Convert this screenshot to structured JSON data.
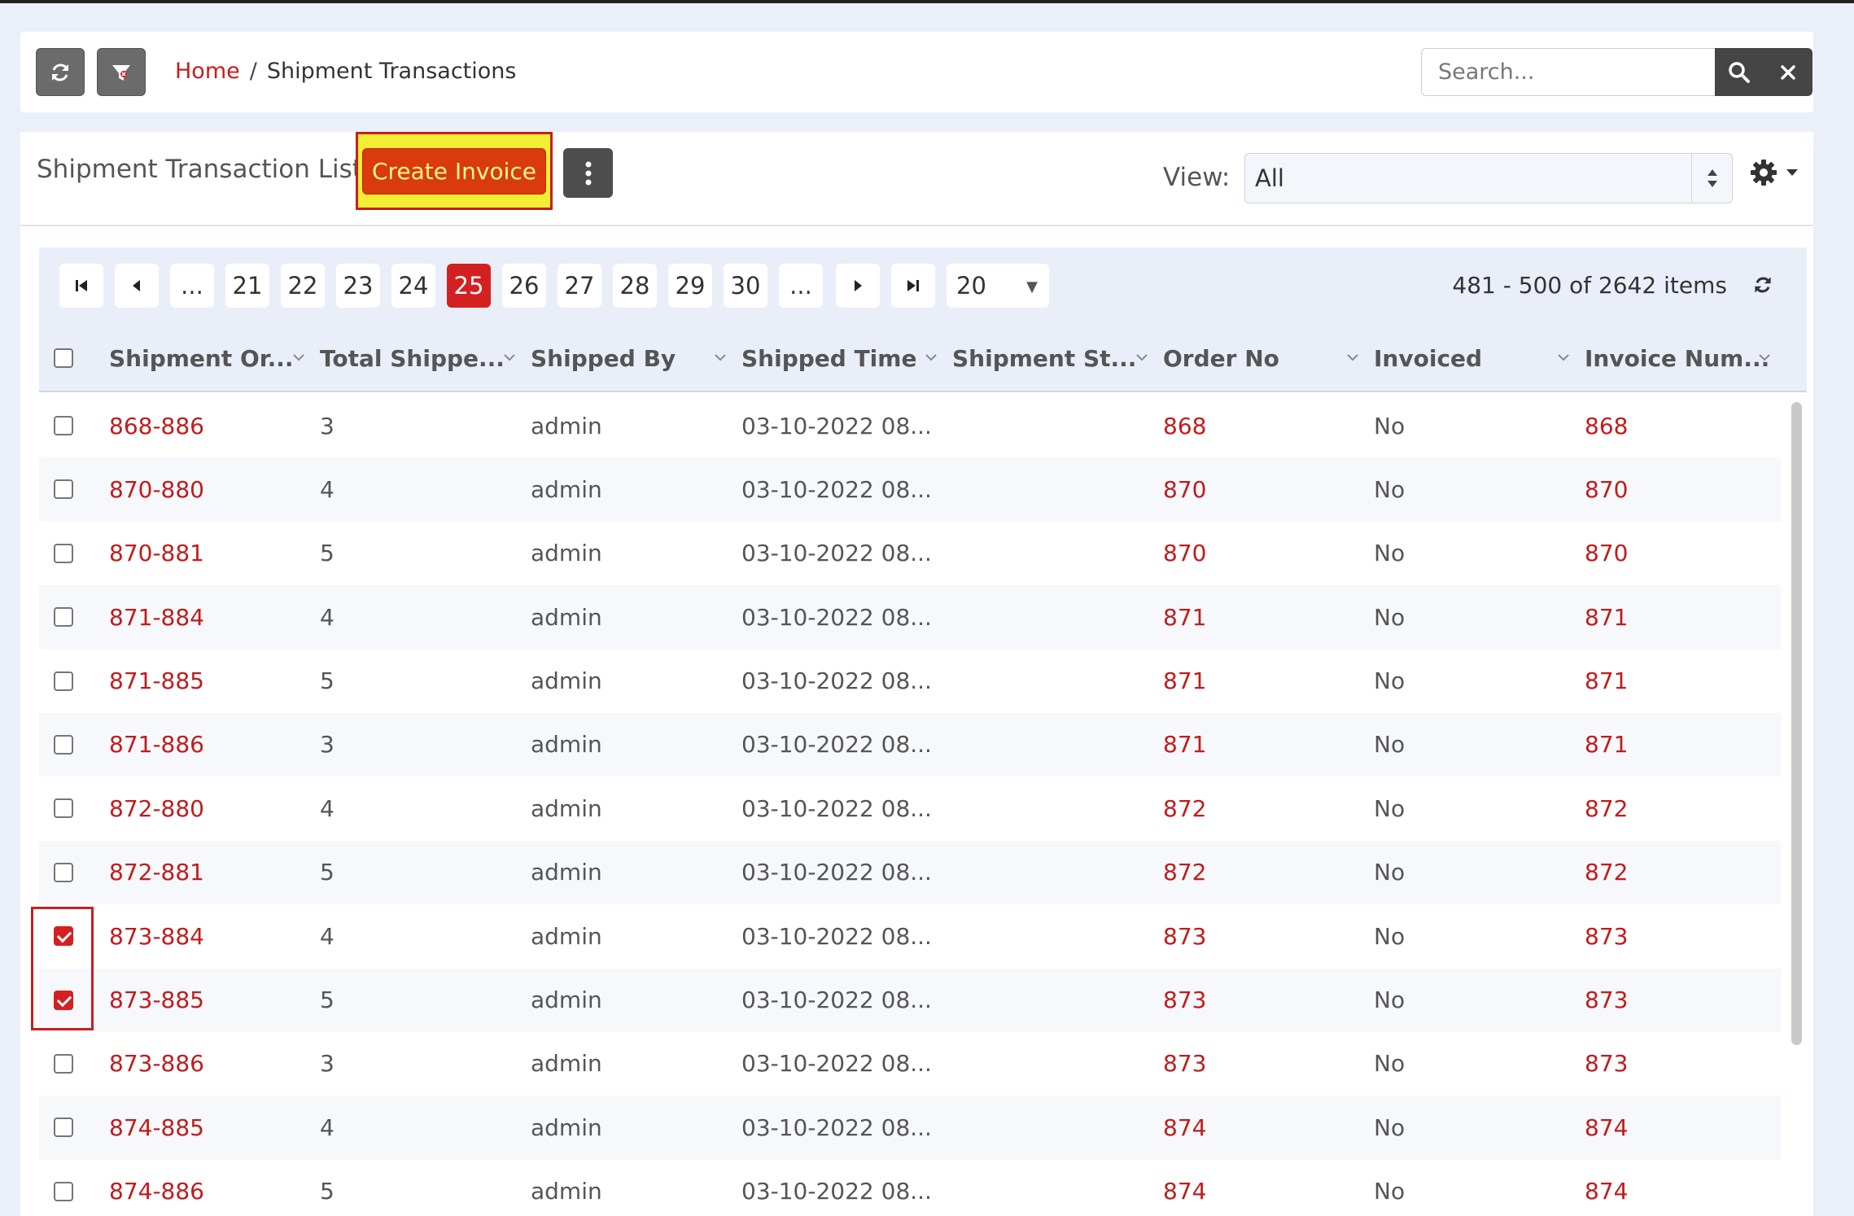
{
  "breadcrumb": {
    "home": "Home",
    "separator": "/",
    "current": "Shipment Transactions"
  },
  "search": {
    "placeholder": "Search..."
  },
  "panel": {
    "title": "Shipment Transaction List",
    "create_button": "Create Invoice",
    "view_label": "View:",
    "view_value": "All"
  },
  "pager": {
    "pages": [
      "...",
      "21",
      "22",
      "23",
      "24",
      "25",
      "26",
      "27",
      "28",
      "29",
      "30",
      "..."
    ],
    "active_page": "25",
    "page_size": "20",
    "info": "481 - 500 of 2642 items"
  },
  "columns": [
    "Shipment Or...",
    "Total Shippe...",
    "Shipped By",
    "Shipped Time",
    "Shipment St...",
    "Order No",
    "Invoiced",
    "Invoice Num..."
  ],
  "rows": [
    {
      "shipment": "868-886",
      "total": "3",
      "by": "admin",
      "time": "03-10-2022 08...",
      "status": "",
      "order": "868",
      "invoiced": "No",
      "invoice_num": "868",
      "checked": false
    },
    {
      "shipment": "870-880",
      "total": "4",
      "by": "admin",
      "time": "03-10-2022 08...",
      "status": "",
      "order": "870",
      "invoiced": "No",
      "invoice_num": "870",
      "checked": false
    },
    {
      "shipment": "870-881",
      "total": "5",
      "by": "admin",
      "time": "03-10-2022 08...",
      "status": "",
      "order": "870",
      "invoiced": "No",
      "invoice_num": "870",
      "checked": false
    },
    {
      "shipment": "871-884",
      "total": "4",
      "by": "admin",
      "time": "03-10-2022 08...",
      "status": "",
      "order": "871",
      "invoiced": "No",
      "invoice_num": "871",
      "checked": false
    },
    {
      "shipment": "871-885",
      "total": "5",
      "by": "admin",
      "time": "03-10-2022 08...",
      "status": "",
      "order": "871",
      "invoiced": "No",
      "invoice_num": "871",
      "checked": false
    },
    {
      "shipment": "871-886",
      "total": "3",
      "by": "admin",
      "time": "03-10-2022 08...",
      "status": "",
      "order": "871",
      "invoiced": "No",
      "invoice_num": "871",
      "checked": false
    },
    {
      "shipment": "872-880",
      "total": "4",
      "by": "admin",
      "time": "03-10-2022 08...",
      "status": "",
      "order": "872",
      "invoiced": "No",
      "invoice_num": "872",
      "checked": false
    },
    {
      "shipment": "872-881",
      "total": "5",
      "by": "admin",
      "time": "03-10-2022 08...",
      "status": "",
      "order": "872",
      "invoiced": "No",
      "invoice_num": "872",
      "checked": false
    },
    {
      "shipment": "873-884",
      "total": "4",
      "by": "admin",
      "time": "03-10-2022 08...",
      "status": "",
      "order": "873",
      "invoiced": "No",
      "invoice_num": "873",
      "checked": true
    },
    {
      "shipment": "873-885",
      "total": "5",
      "by": "admin",
      "time": "03-10-2022 08...",
      "status": "",
      "order": "873",
      "invoiced": "No",
      "invoice_num": "873",
      "checked": true
    },
    {
      "shipment": "873-886",
      "total": "3",
      "by": "admin",
      "time": "03-10-2022 08...",
      "status": "",
      "order": "873",
      "invoiced": "No",
      "invoice_num": "873",
      "checked": false
    },
    {
      "shipment": "874-885",
      "total": "4",
      "by": "admin",
      "time": "03-10-2022 08...",
      "status": "",
      "order": "874",
      "invoiced": "No",
      "invoice_num": "874",
      "checked": false
    },
    {
      "shipment": "874-886",
      "total": "5",
      "by": "admin",
      "time": "03-10-2022 08...",
      "status": "",
      "order": "874",
      "invoiced": "No",
      "invoice_num": "874",
      "checked": false
    }
  ],
  "colors": {
    "accent": "#c01c1c",
    "active_page": "#d32121",
    "create_button": "#d93a0e",
    "highlight": "#f3ee32"
  },
  "icons": {
    "refresh": "refresh-icon",
    "filter": "filter-icon",
    "search": "search-icon",
    "clear": "close-icon",
    "more": "kebab-icon",
    "settings": "gear-icon"
  }
}
